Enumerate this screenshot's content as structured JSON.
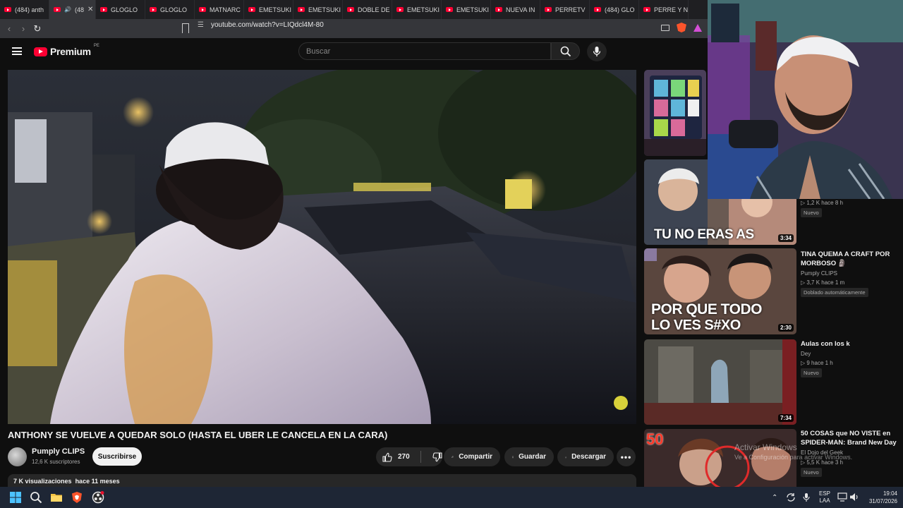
{
  "browser": {
    "tabs": [
      {
        "label": "(484) anth",
        "active": false
      },
      {
        "label": "(48",
        "active": true
      },
      {
        "label": "GLOGLO",
        "active": false
      },
      {
        "label": "GLOGLO",
        "active": false
      },
      {
        "label": "MATNARC",
        "active": false
      },
      {
        "label": "EMETSUKI",
        "active": false
      },
      {
        "label": "EMETSUKI",
        "active": false
      },
      {
        "label": "DOBLE DE",
        "active": false
      },
      {
        "label": "EMETSUKI",
        "active": false
      },
      {
        "label": "EMETSUKI",
        "active": false
      },
      {
        "label": "NUEVA IN",
        "active": false
      },
      {
        "label": "PERRETV",
        "active": false
      },
      {
        "label": "(484) GLO",
        "active": false
      },
      {
        "label": "PERRE Y N",
        "active": false
      }
    ],
    "url": "youtube.com/watch?v=LIQdcl4M-80",
    "icons": [
      "back-icon",
      "forward-icon",
      "reload-icon",
      "bookmark-icon",
      "site-info-icon",
      "cast-icon",
      "brave-shield-icon",
      "brave-rewards-icon"
    ]
  },
  "youtube": {
    "logo_text": "Premium",
    "country": "PE",
    "search_placeholder": "Buscar",
    "video": {
      "title": "ANTHONY SE VUELVE A QUEDAR SOLO (HASTA EL UBER LE CANCELA EN LA CARA)",
      "channel": "Pumply CLIPS",
      "subscribers": "12,6 K suscriptores",
      "subscribe_label": "Suscribirse",
      "likes": "270",
      "share_label": "Compartir",
      "save_label": "Guardar",
      "download_label": "Descargar",
      "views": "7 K visualizaciones",
      "age": "hace 11 meses"
    },
    "recommendations": [
      {
        "title": "",
        "meta": "",
        "duration": "",
        "badge": ""
      },
      {
        "thumb_text": "TU NO ERAS AS",
        "meta": "▷ 1,2 K  hace 8 h",
        "duration": "3:34",
        "badge": "Nuevo"
      },
      {
        "thumb_text_1": "POR QUE TODO",
        "thumb_text_2": "LO VES S#XO",
        "title": "TINA QUEMA A CRAFT POR MORBOSO 🗿",
        "channel": "Pumply CLIPS",
        "meta": "▷ 3,7 K  hace 1 m",
        "duration": "2:30",
        "badge": "Doblado automáticamente"
      },
      {
        "title": "Aulas con los k",
        "channel": "Dey",
        "meta": "▷ 9  hace 1 h",
        "duration": "7:34",
        "badge": "Nuevo"
      },
      {
        "thumb_text": "50",
        "title": "50 COSAS que NO VISTE en SPIDER-MAN: Brand New Day",
        "channel": "El Dojo del Geek",
        "meta": "▷ 5,5 K  hace 3 h",
        "badge": "Nuevo"
      }
    ]
  },
  "watermark": {
    "line1": "Activar Windows",
    "line2": "Ve a Configuración para activar Windows."
  },
  "taskbar": {
    "lang": "ESP",
    "layout": "LAA",
    "time": "19:04",
    "date": "31/07/2026"
  }
}
